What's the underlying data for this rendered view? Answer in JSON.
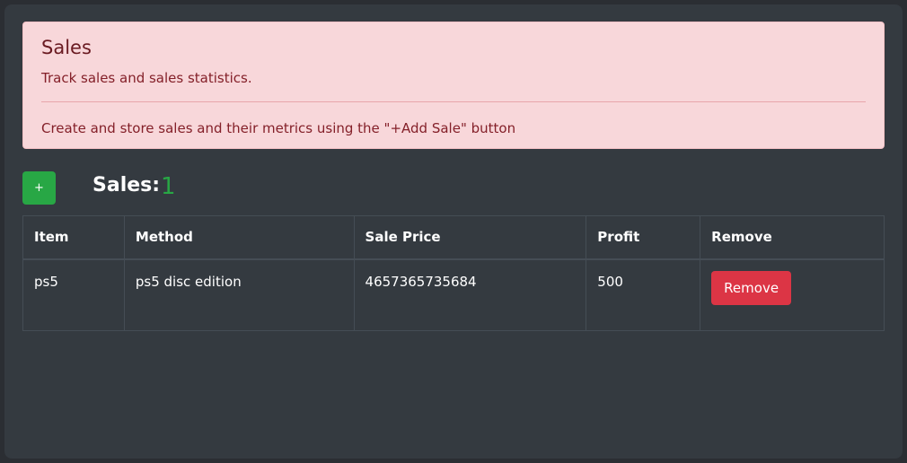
{
  "alert": {
    "title": "Sales",
    "subtitle": "Track sales and sales statistics.",
    "note": "Create and store sales and their metrics using the \"+Add Sale\" button"
  },
  "toolbar": {
    "add_label": "+",
    "count_label": "Sales:",
    "count_value": "1"
  },
  "table": {
    "columns": [
      "Item",
      "Method",
      "Sale Price",
      "Profit",
      "Remove"
    ],
    "rows": [
      {
        "item": "ps5",
        "method": "ps5 disc edition",
        "sale_price": "4657365735684",
        "profit": "500",
        "remove_label": "Remove"
      }
    ]
  },
  "colors": {
    "alert_bg": "#f8d7da",
    "alert_text": "#842029",
    "success": "#28a745",
    "danger": "#dc3545",
    "panel_bg": "#343a40"
  }
}
